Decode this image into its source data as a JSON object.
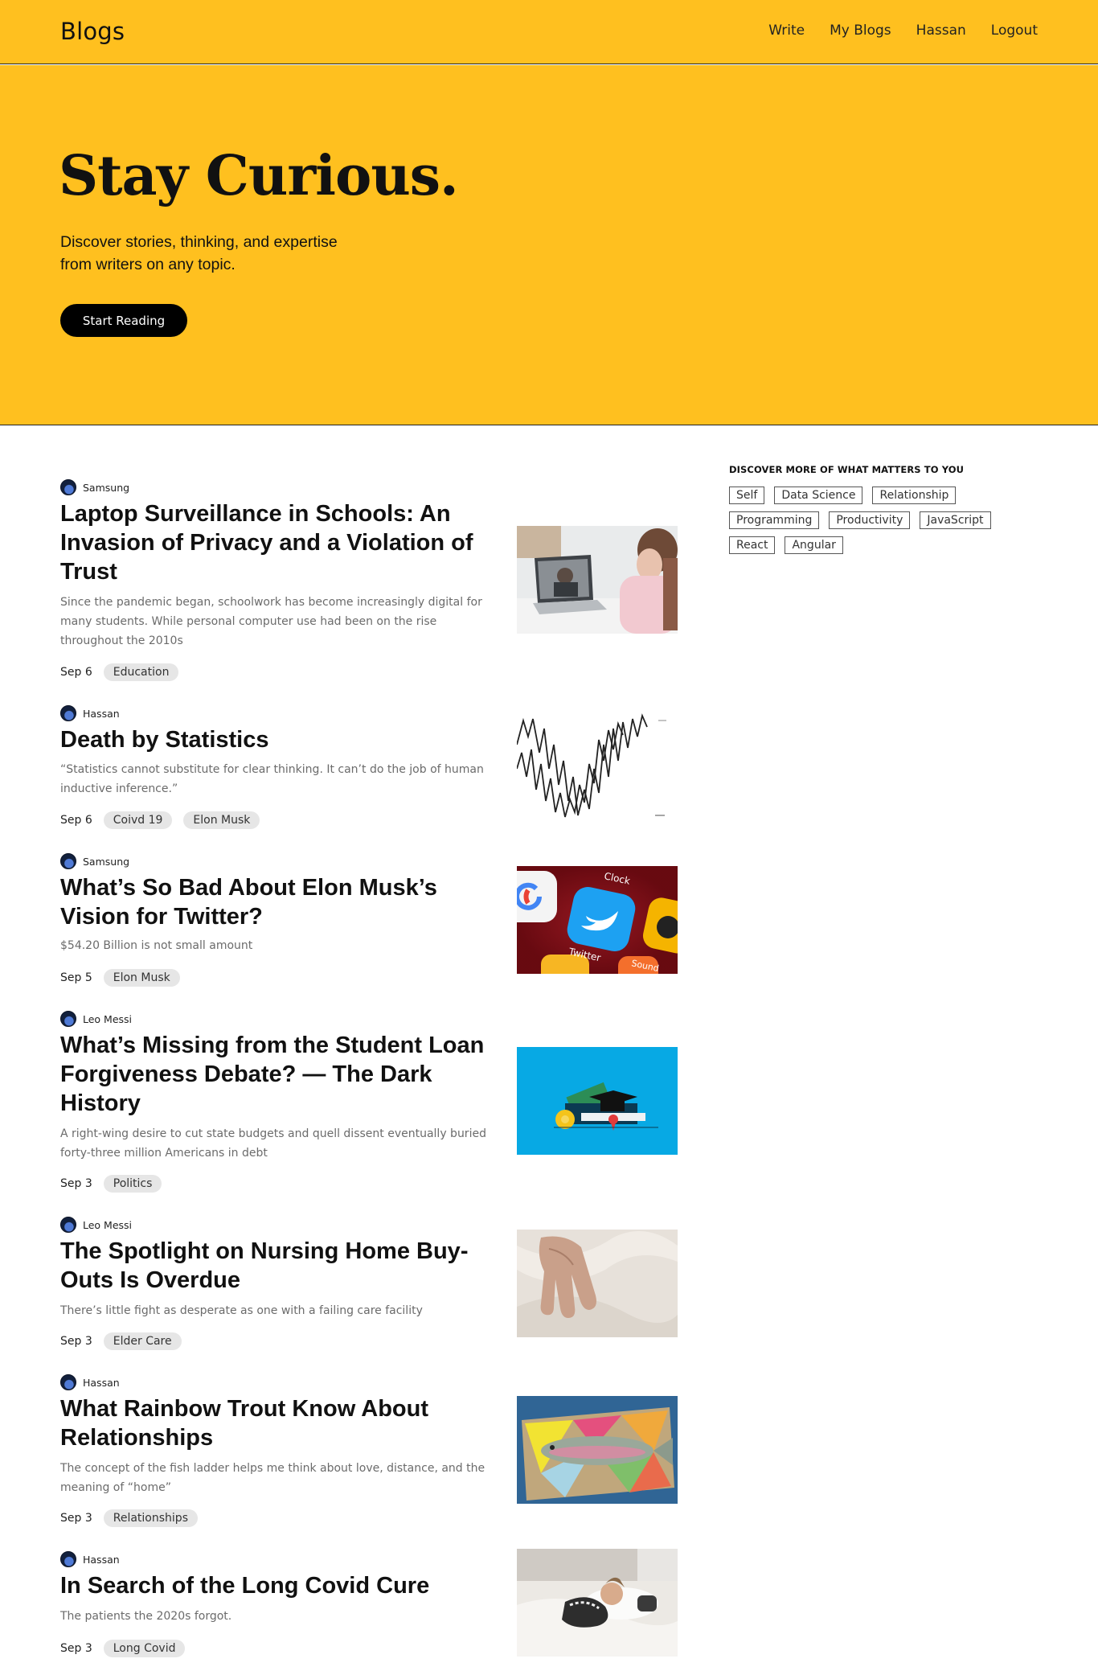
{
  "header": {
    "brand": "Blogs",
    "nav": [
      "Write",
      "My Blogs",
      "Hassan",
      "Logout"
    ]
  },
  "hero": {
    "title": "Stay Curious.",
    "subtitle": "Discover stories, thinking, and expertise from writers on any topic.",
    "button": "Start Reading"
  },
  "sidebar": {
    "heading": "DISCOVER MORE OF WHAT MATTERS TO YOU",
    "tags": [
      "Self",
      "Data Science",
      "Relationship",
      "Programming",
      "Productivity",
      "JavaScript",
      "React",
      "Angular"
    ]
  },
  "posts": [
    {
      "author": "Samsung",
      "title": "Laptop Surveillance in Schools: An Invasion of Privacy and a Violation of Trust",
      "description": "Since the pandemic began, schoolwork has become increasingly digital for many students. While personal computer use had been on the rise throughout the 2010s",
      "date": "Sep 6",
      "tags": [
        "Education"
      ],
      "image": "laptop-student-photo"
    },
    {
      "author": "Hassan",
      "title": "Death by Statistics",
      "description": "“Statistics cannot substitute for clear thinking. It can’t do the job of human inductive inference.”",
      "date": "Sep 6",
      "tags": [
        "Coivd 19",
        "Elon Musk"
      ],
      "image": "statistics-line-chart"
    },
    {
      "author": "Samsung",
      "title": "What’s So Bad About Elon Musk’s Vision for Twitter?",
      "description": "$54.20 Billion is not small amount",
      "date": "Sep 5",
      "tags": [
        "Elon Musk"
      ],
      "image": "twitter-app-icons"
    },
    {
      "author": "Leo Messi",
      "title": "What’s Missing from the Student Loan Forgiveness Debate? — The Dark History",
      "description": "A right-wing desire to cut state budgets and quell dissent eventually buried forty-three million Americans in debt",
      "date": "Sep 3",
      "tags": [
        "Politics"
      ],
      "image": "graduation-cap-money-illustration"
    },
    {
      "author": "Leo Messi",
      "title": "The Spotlight on Nursing Home Buy-Outs Is Overdue",
      "description": "There’s little fight as desperate as one with a failing care facility",
      "date": "Sep 3",
      "tags": [
        "Elder Care"
      ],
      "image": "elderly-hand-photo"
    },
    {
      "author": "Hassan",
      "title": "What Rainbow Trout Know About Relationships",
      "description": "The concept of the fish ladder helps me think about love, distance, and the meaning of “home”",
      "date": "Sep 3",
      "tags": [
        "Relationships"
      ],
      "image": "trout-painting"
    },
    {
      "author": "Hassan",
      "title": "In Search of the Long Covid Cure",
      "description": "The patients the 2020s forgot.",
      "date": "Sep 3",
      "tags": [
        "Long Covid"
      ],
      "image": "patient-in-bed-photo"
    }
  ]
}
